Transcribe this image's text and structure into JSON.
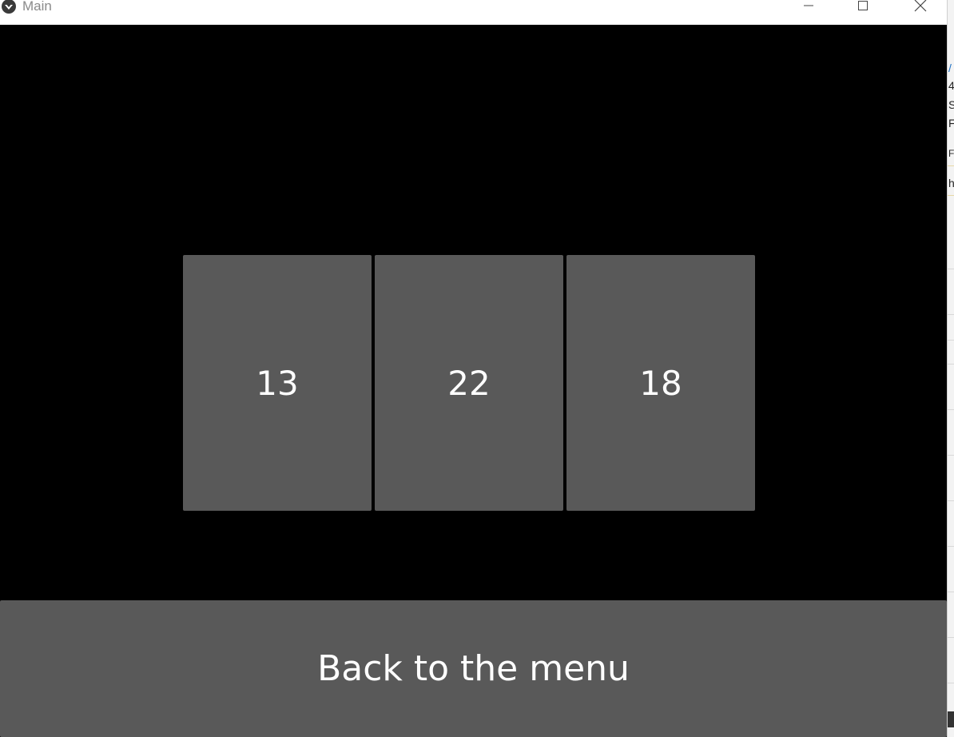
{
  "window": {
    "title": "Main",
    "app_icon": "kivy-logo-icon",
    "controls": {
      "minimize": "minimize-icon",
      "maximize": "maximize-icon",
      "close": "close-icon"
    }
  },
  "cards": [
    {
      "label": "13"
    },
    {
      "label": "22"
    },
    {
      "label": "18"
    }
  ],
  "back_button": {
    "label": "Back to the menu"
  },
  "background_window": {
    "glyphs": [
      "/",
      "4",
      "S",
      "Fi",
      "F",
      "h"
    ]
  },
  "colors": {
    "canvas": "#000000",
    "button": "#595959",
    "button_text": "#ffffff"
  }
}
